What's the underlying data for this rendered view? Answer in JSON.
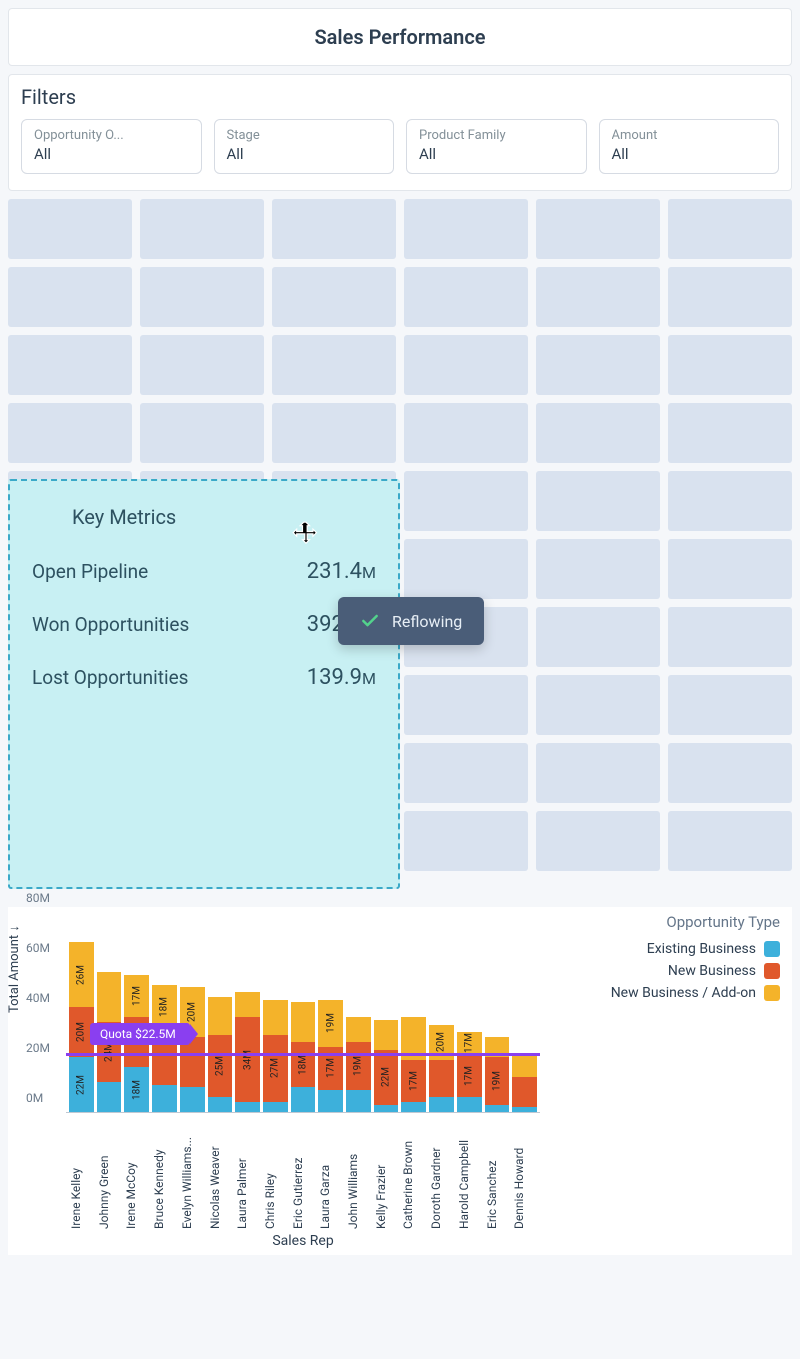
{
  "header": {
    "title": "Sales Performance"
  },
  "filters": {
    "title": "Filters",
    "items": [
      {
        "label": "Opportunity O...",
        "value": "All"
      },
      {
        "label": "Stage",
        "value": "All"
      },
      {
        "label": "Product Family",
        "value": "All"
      },
      {
        "label": "Amount",
        "value": "All"
      }
    ]
  },
  "key_metrics": {
    "title": "Key Metrics",
    "rows": [
      {
        "label": "Open Pipeline",
        "value": "231.4",
        "unit": "M"
      },
      {
        "label": "Won Opportunities",
        "value": "392.2",
        "unit": "M"
      },
      {
        "label": "Lost Opportunities",
        "value": "139.9",
        "unit": "M"
      }
    ]
  },
  "toast": {
    "text": "Reflowing"
  },
  "legend": {
    "title": "Opportunity Type",
    "items": [
      {
        "label": "Existing Business",
        "color": "#3db0db"
      },
      {
        "label": "New Business",
        "color": "#e0582b"
      },
      {
        "label": "New Business / Add-on",
        "color": "#f4b32a"
      }
    ]
  },
  "chart_data": {
    "type": "bar",
    "title": "",
    "xlabel": "Sales Rep",
    "ylabel": "Total Amount ↓",
    "ylim": [
      0,
      80
    ],
    "yticks": [
      0,
      20,
      40,
      60,
      80
    ],
    "ytick_suffix": "M",
    "quota": {
      "label": "Quota $22.5M",
      "value": 22.5
    },
    "categories": [
      "Irene Kelley",
      "Johnny Green",
      "Irene McCoy",
      "Bruce Kennedy",
      "Evelyn Williams...",
      "Nicolas Weaver",
      "Laura Palmer",
      "Chris Riley",
      "Eric Gutierrez",
      "Laura Garza",
      "John Williams",
      "Kelly Frazier",
      "Catherine Brown",
      "Doroth Gardner",
      "Harold Campbell",
      "Eric Sanchez",
      "Dennis Howard"
    ],
    "series": [
      {
        "name": "Existing Business",
        "color": "#3db0db",
        "values": [
          22,
          12,
          18,
          11,
          10,
          6,
          4,
          4,
          10,
          9,
          9,
          3,
          4,
          6,
          6,
          3,
          2
        ]
      },
      {
        "name": "New Business",
        "color": "#e0582b",
        "values": [
          20,
          24,
          20,
          22,
          20,
          25,
          34,
          27,
          18,
          17,
          19,
          22,
          17,
          15,
          17,
          19,
          12
        ]
      },
      {
        "name": "New Business / Add-on",
        "color": "#f4b32a",
        "values": [
          26,
          20,
          17,
          18,
          20,
          15,
          10,
          14,
          16,
          19,
          10,
          12,
          17,
          14,
          9,
          8,
          9
        ]
      }
    ],
    "bar_labels": [
      [
        "22M",
        "20M",
        "26M"
      ],
      [
        "",
        "24M",
        ""
      ],
      [
        "18M",
        "",
        "17M"
      ],
      [
        "",
        "",
        "18M"
      ],
      [
        "",
        "",
        "20M"
      ],
      [
        "",
        "25M",
        ""
      ],
      [
        "",
        "34M",
        ""
      ],
      [
        "",
        "27M",
        ""
      ],
      [
        "",
        "18M",
        ""
      ],
      [
        "",
        "17M",
        "19M"
      ],
      [
        "",
        "19M",
        ""
      ],
      [
        "",
        "22M",
        ""
      ],
      [
        "",
        "17M",
        ""
      ],
      [
        "",
        "",
        "20M"
      ],
      [
        "",
        "17M",
        "17M"
      ],
      [
        "",
        "19M",
        ""
      ],
      [
        "",
        "",
        ""
      ]
    ]
  }
}
